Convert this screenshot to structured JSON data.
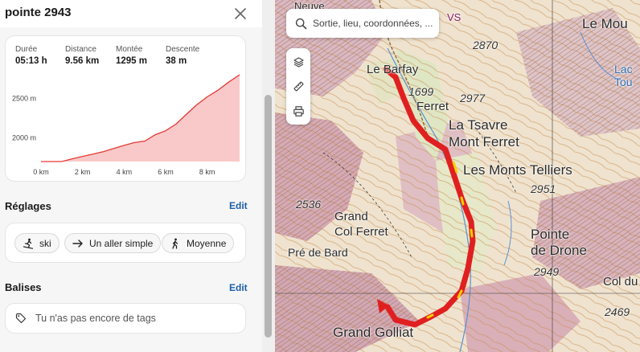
{
  "panel": {
    "title": "pointe 2943"
  },
  "stats": [
    {
      "label": "Durée",
      "value": "05:13 h"
    },
    {
      "label": "Distance",
      "value": "9.56 km"
    },
    {
      "label": "Montée",
      "value": "1295 m"
    },
    {
      "label": "Descente",
      "value": "38 m"
    }
  ],
  "chart_data": {
    "type": "area",
    "title": "",
    "xlabel": "",
    "ylabel": "",
    "x_ticks": [
      "0 km",
      "2 km",
      "4 km",
      "6 km",
      "8 km"
    ],
    "y_ticks": [
      "2000 m",
      "2500 m"
    ],
    "xlim": [
      0,
      9.56
    ],
    "ylim": [
      1700,
      2800
    ],
    "color": "#e53935",
    "fill": "#f9c9c9",
    "series": [
      {
        "x": [
          0,
          0.5,
          1,
          1.5,
          2,
          2.5,
          3,
          3.5,
          4,
          4.5,
          5,
          5.5,
          6,
          6.5,
          7,
          7.5,
          8,
          8.5,
          9,
          9.56
        ],
        "y": [
          1640,
          1665,
          1700,
          1735,
          1765,
          1795,
          1825,
          1865,
          1905,
          1940,
          1960,
          2040,
          2090,
          2175,
          2300,
          2420,
          2520,
          2600,
          2700,
          2900
        ]
      }
    ]
  },
  "settings": {
    "heading": "Réglages",
    "edit": "Edit",
    "chips": [
      {
        "label": "ski",
        "icon": "skier-icon"
      },
      {
        "label": "Un aller simple",
        "icon": "arrow-right-icon"
      },
      {
        "label": "Moyenne",
        "icon": "hiker-icon"
      }
    ]
  },
  "tags": {
    "heading": "Balises",
    "edit": "Edit",
    "empty": "Tu n'as pas encore de tags"
  },
  "map": {
    "search_placeholder": "Sortie, lieu, coordonnées, ...",
    "labels": [
      "Le Barfay",
      "1699",
      "Ferret",
      "2977",
      "La Tsavre",
      "Mont Ferret",
      "Les Monts Telliers",
      "2951",
      "2536",
      "Grand",
      "Col Ferret",
      "Pré de Bard",
      "Pointe",
      "de Drone",
      "2949",
      "Col du",
      "2469",
      "Grand Golliat",
      "2870",
      "Le Mou",
      "Lac",
      "Tou",
      "Neuve",
      "VS"
    ],
    "tools": [
      "layers-icon",
      "ruler-icon",
      "print-icon"
    ],
    "colors": {
      "route": "#e02020",
      "route_highlight": "#f5d000"
    }
  }
}
